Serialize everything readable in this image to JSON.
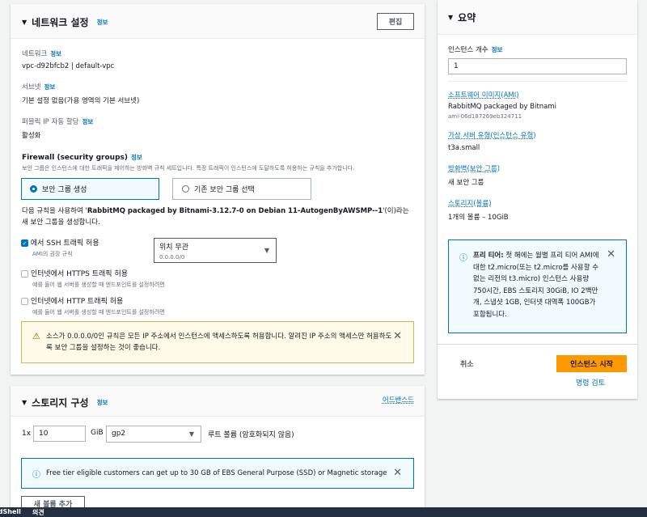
{
  "network": {
    "title": "네트워크 설정",
    "info": "정보",
    "edit": "편집",
    "network_label": "네트워크",
    "network_value": "vpc-d92bfcb2 | default-vpc",
    "subnet_label": "서브넷",
    "subnet_value": "기본 설정 없음(가용 영역의 기본 서브넷)",
    "public_ip_label": "퍼블릭 IP 자동 할당",
    "public_ip_value": "활성화",
    "firewall_title": "Firewall (security groups)",
    "firewall_desc": "보안 그룹은 인스턴스에 대한 트래픽을 제어하는 방화벽 규칙 세트입니다. 특정 트래픽이 인스턴스에 도달하도록 허용하는 규칙을 추가합니다.",
    "radio_create": "보안 그룹 생성",
    "radio_existing": "기존 보안 그룹 선택",
    "rule_intro_pre": "다음 규칙을 사용하여 '",
    "rule_intro_name": "RabbitMQ packaged by Bitnami-3.12.7-0 on Debian 11-AutogenByAWSMP--1",
    "rule_intro_post": "'(이)라는 새 보안 그룹을 생성합니다.",
    "ssh_label": "에서 SSH 트래픽 허용",
    "ssh_sub": "AMI의 권장 규칙",
    "ssh_checked": true,
    "source_select": "위치 무관",
    "source_cidr": "0.0.0.0/0",
    "https_label": "인터넷에서 HTTPS 트래픽 허용",
    "https_sub": "예를 들어 웹 서버를 생성할 때 엔드포인트를 설정하려면",
    "https_checked": false,
    "http_label": "인터넷에서 HTTP 트래픽 허용",
    "http_sub": "예를 들어 웹 서버를 생성할 때 엔드포인트를 설정하려면",
    "http_checked": false,
    "warning": "소스가 0.0.0.0/0인 규칙은 모든 IP 주소에서 인스턴스에 액세스하도록 허용합니다. 알려진 IP 주소의 액세스만 허용하도록 보안 그룹을 설정하는 것이 좋습니다."
  },
  "storage": {
    "title": "스토리지 구성",
    "info": "정보",
    "advanced": "어드밴스드",
    "count": "1x",
    "size": "10",
    "unit": "GiB",
    "type": "gp2",
    "root_label": "루트 볼륨  (암호화되지 않음)",
    "notice": "Free tier eligible customers can get up to 30 GB of EBS General Purpose (SSD) or Magnetic storage",
    "add_volume": "새 볼륨 추가"
  },
  "summary": {
    "title": "요약",
    "instances_label": "인스턴스 개수",
    "info": "정보",
    "instances_value": "1",
    "ami_label": "소프트웨어 이미지(AMI)",
    "ami_value": "RabbitMQ packaged by Bitnami",
    "ami_id": "ami-06d187269eb324711",
    "type_label": "가상 서버 유형(인스턴스 유형)",
    "type_value": "t3a.small",
    "fw_label": "방화벽(보안 그룹)",
    "fw_value": "새 보안 그룹",
    "storage_label": "스토리지(볼륨)",
    "storage_value": "1개의 볼륨 – 10GiB",
    "free_tier_bold": "프리 티어:",
    "free_tier_text": " 첫 해에는 월별 프리 티어 AMI에 대한 t2.micro(또는 t2.micro를 사용할 수 없는 리전의 t3.micro) 인스턴스 사용량 750시간, EBS 스토리지 30GiB, IO 2백만 개, 스냅샷 1GB, 인터넷 대역폭 100GB가 포함됩니다.",
    "cancel": "취소",
    "launch": "인스턴스 시작",
    "review": "명령 검토"
  },
  "footer": {
    "cloudshell": "CloudShell",
    "feedback": "의견"
  }
}
